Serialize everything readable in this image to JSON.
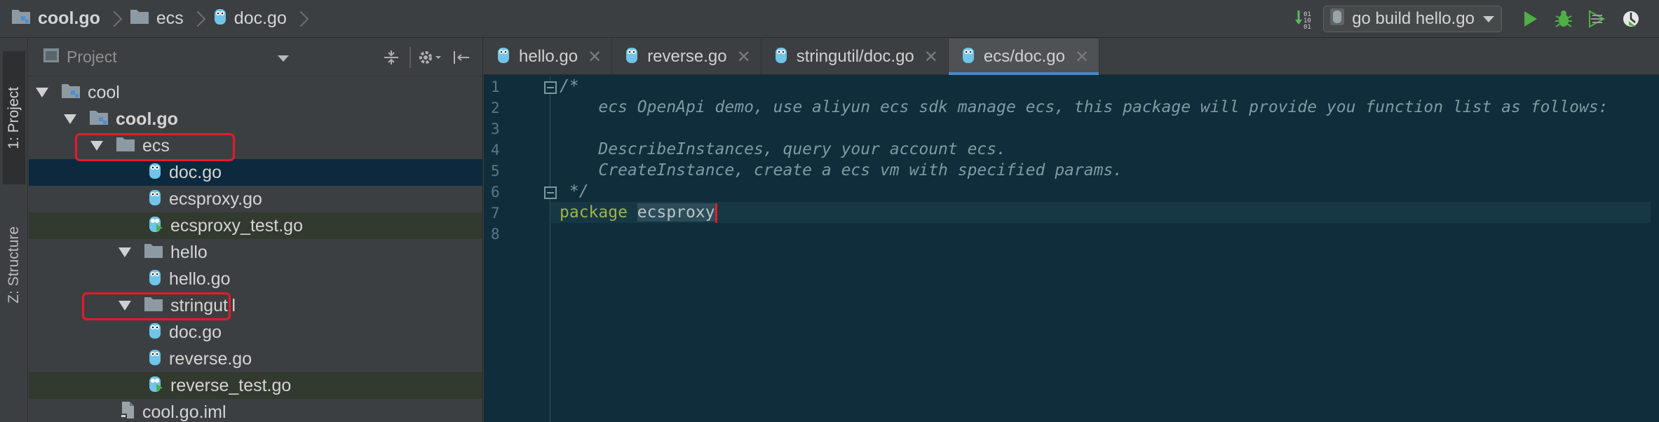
{
  "navbar": {
    "breadcrumbs": [
      {
        "label": "cool.go",
        "icon": "module-folder-icon"
      },
      {
        "label": "ecs",
        "icon": "folder-icon"
      },
      {
        "label": "doc.go",
        "icon": "go-file-icon"
      }
    ],
    "run_config": "go build hello.go",
    "toolbar_icons": [
      "vcs-update-icon",
      "run-icon",
      "debug-icon",
      "coverage-icon",
      "profile-icon"
    ]
  },
  "side_tabs": {
    "project": "1: Project",
    "structure": "Z: Structure"
  },
  "project_panel": {
    "title": "Project",
    "tree": [
      {
        "label": "cool",
        "type": "module",
        "depth": 0,
        "expanded": true
      },
      {
        "label": "cool.go",
        "type": "module",
        "depth": 1,
        "expanded": true,
        "bold": true
      },
      {
        "label": "ecs",
        "type": "folder",
        "depth": 2,
        "expanded": true,
        "highlighted": true
      },
      {
        "label": "doc.go",
        "type": "go",
        "depth": 3,
        "selected": true
      },
      {
        "label": "ecsproxy.go",
        "type": "go",
        "depth": 3
      },
      {
        "label": "ecsproxy_test.go",
        "type": "go-test",
        "depth": 3
      },
      {
        "label": "hello",
        "type": "folder",
        "depth": 2,
        "expanded": true
      },
      {
        "label": "hello.go",
        "type": "go",
        "depth": 3
      },
      {
        "label": "stringutil",
        "type": "folder",
        "depth": 2,
        "expanded": true,
        "highlighted": true
      },
      {
        "label": "doc.go",
        "type": "go",
        "depth": 3
      },
      {
        "label": "reverse.go",
        "type": "go",
        "depth": 3
      },
      {
        "label": "reverse_test.go",
        "type": "go-test",
        "depth": 3
      },
      {
        "label": "cool.go.iml",
        "type": "iml",
        "depth": 2
      }
    ]
  },
  "editor": {
    "tabs": [
      {
        "label": "hello.go",
        "active": false
      },
      {
        "label": "reverse.go",
        "active": false
      },
      {
        "label": "stringutil/doc.go",
        "active": false
      },
      {
        "label": "ecs/doc.go",
        "active": true
      }
    ],
    "line_numbers": [
      "1",
      "2",
      "3",
      "4",
      "5",
      "6",
      "7",
      "8"
    ],
    "code": {
      "l1": "/*",
      "l2": "    ecs OpenApi demo, use aliyun ecs sdk manage ecs, this package will provide you function list as follows:",
      "l3": "",
      "l4": "    DescribeInstances, query your account ecs.",
      "l5": "    CreateInstance, create a ecs vm with specified params.",
      "l6": " */",
      "l7_keyword": "package",
      "l7_name": "ecsproxy",
      "l8": ""
    }
  },
  "colors": {
    "highlight_box": "#e8192c",
    "editor_bg": "#0f2d3a",
    "keyword": "#9fb34a",
    "comment": "#7f9aa3",
    "selection": "#0d293e",
    "active_tab_underline": "#4a88c7"
  }
}
